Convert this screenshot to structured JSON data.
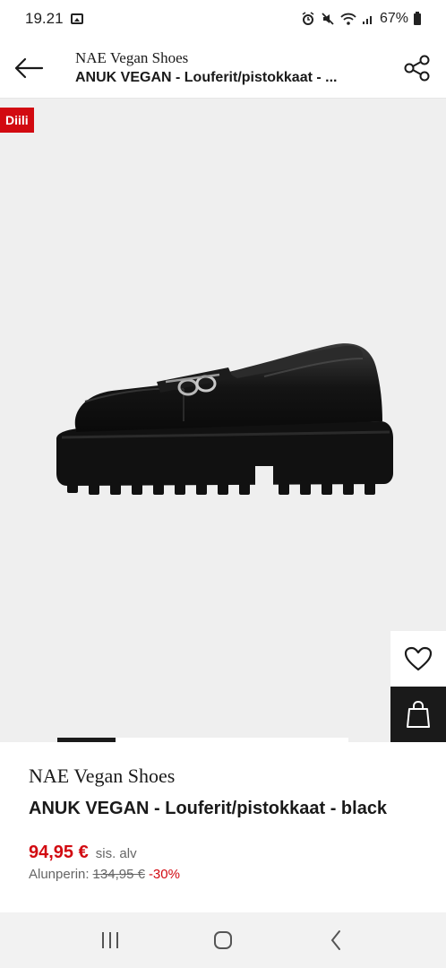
{
  "status_bar": {
    "time": "19.21",
    "battery": "67%"
  },
  "header": {
    "brand": "NAE Vegan Shoes",
    "product": "ANUK VEGAN  - Louferit/pistokkaat - ..."
  },
  "gallery": {
    "badge": "Diili"
  },
  "product": {
    "brand": "NAE Vegan Shoes",
    "name": "ANUK VEGAN  - Louferit/pistokkaat - black",
    "price": "94,95 €",
    "vat_note": "sis. alv",
    "original_label": "Alunperin:",
    "original_price": "134,95 €",
    "discount": "-30%"
  },
  "colors": {
    "accent": "#d20a11",
    "dark": "#1a1a1a"
  }
}
